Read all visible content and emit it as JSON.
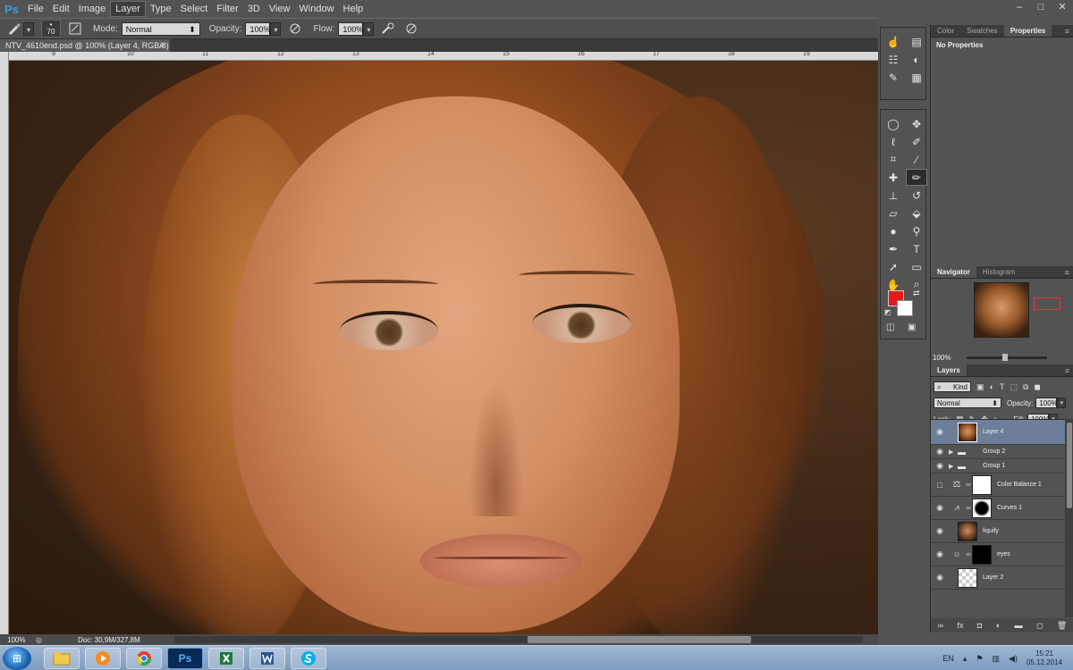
{
  "app": {
    "logo": "Ps"
  },
  "menu": [
    "File",
    "Edit",
    "Image",
    "Layer",
    "Type",
    "Select",
    "Filter",
    "3D",
    "View",
    "Window",
    "Help"
  ],
  "window_controls": [
    "–",
    "□",
    "✕"
  ],
  "options": {
    "brush_size": "70",
    "mode_label": "Mode:",
    "mode_value": "Normal",
    "opacity_label": "Opacity:",
    "opacity_value": "100%",
    "flow_label": "Flow:",
    "flow_value": "100%"
  },
  "document": {
    "tab_title": "NTV_4610end.psd @ 100% (Layer 4, RGB/8) *",
    "close": "×",
    "ruler_numbers": [
      "9",
      "10",
      "11",
      "12",
      "13",
      "14",
      "15",
      "16",
      "17",
      "18",
      "19"
    ]
  },
  "status": {
    "zoom": "100%",
    "doc_info": "Doc: 30,9M/327,8M"
  },
  "panels": {
    "top_tabs": [
      "Color",
      "Swatches",
      "Properties"
    ],
    "active_top_tab": "Properties",
    "properties_text": "No Properties",
    "navigator_tabs": [
      "Navigator",
      "Histogram"
    ],
    "navigator_zoom": "100%",
    "layers_tab": "Layers",
    "kind_label": "Kind",
    "blend_mode": "Normal",
    "opacity_label": "Opacity:",
    "opacity_value": "100%",
    "lock_label": "Lock:",
    "fill_label": "Fill:",
    "fill_value": "100%"
  },
  "layers": [
    {
      "name": "Layer 4",
      "selected": true
    },
    {
      "name": "Group 2"
    },
    {
      "name": "Group 1"
    },
    {
      "name": "Color Balance 1"
    },
    {
      "name": "Curves 1"
    },
    {
      "name": "liquify"
    },
    {
      "name": "eyes"
    },
    {
      "name": "Layer 2"
    }
  ],
  "colors": {
    "foreground": "#e51a1a",
    "background": "#ffffff",
    "selection": "#6b7f9b"
  },
  "taskbar": {
    "apps": [
      "explorer-icon",
      "media-player-icon",
      "chrome-icon",
      "photoshop-icon",
      "excel-icon",
      "word-icon",
      "skype-icon"
    ],
    "ps_label": "Ps",
    "language": "EN",
    "time": "15:21",
    "date": "05.12.2014"
  }
}
